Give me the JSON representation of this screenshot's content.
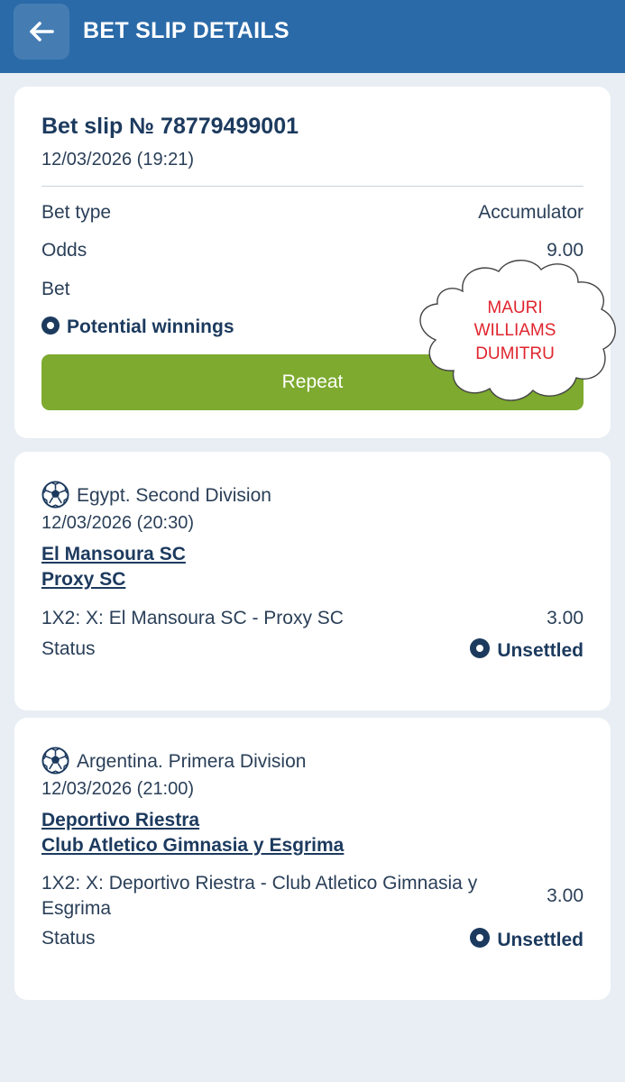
{
  "header": {
    "title": "BET SLIP DETAILS",
    "back_icon": "arrow-left-icon"
  },
  "summary": {
    "title": "Bet slip № 78779499001",
    "date": "12/03/2026 (19:21)",
    "bet_type_label": "Bet type",
    "bet_type_value": "Accumulator",
    "odds_label": "Odds",
    "odds_value": "9.00",
    "bet_label": "Bet",
    "potential_label": "Potential winnings",
    "repeat_label": "Repeat"
  },
  "stamp": {
    "lines": [
      "MAURI",
      "WILLIAMS",
      "DUMITRU"
    ],
    "color": "#e0252e"
  },
  "events": [
    {
      "league": "Egypt. Second Division",
      "date": "12/03/2026 (20:30)",
      "team1": "El Mansoura SC",
      "team2": "Proxy SC",
      "market": "1X2: X: El Mansoura SC - Proxy SC",
      "odds": "3.00",
      "status_label": "Status",
      "status_value": "Unsettled"
    },
    {
      "league": "Argentina. Primera Division",
      "date": "12/03/2026 (21:00)",
      "team1": "Deportivo Riestra",
      "team2": "Club Atletico Gimnasia y Esgrima",
      "market": "1X2: X: Deportivo Riestra - Club Atletico Gimnasia y Esgrima",
      "odds": "3.00",
      "status_label": "Status",
      "status_value": "Unsettled"
    }
  ],
  "colors": {
    "header": "#2a6aa8",
    "accent": "#7daa2f",
    "text": "#1c3a5e",
    "background": "#e8eef3"
  }
}
